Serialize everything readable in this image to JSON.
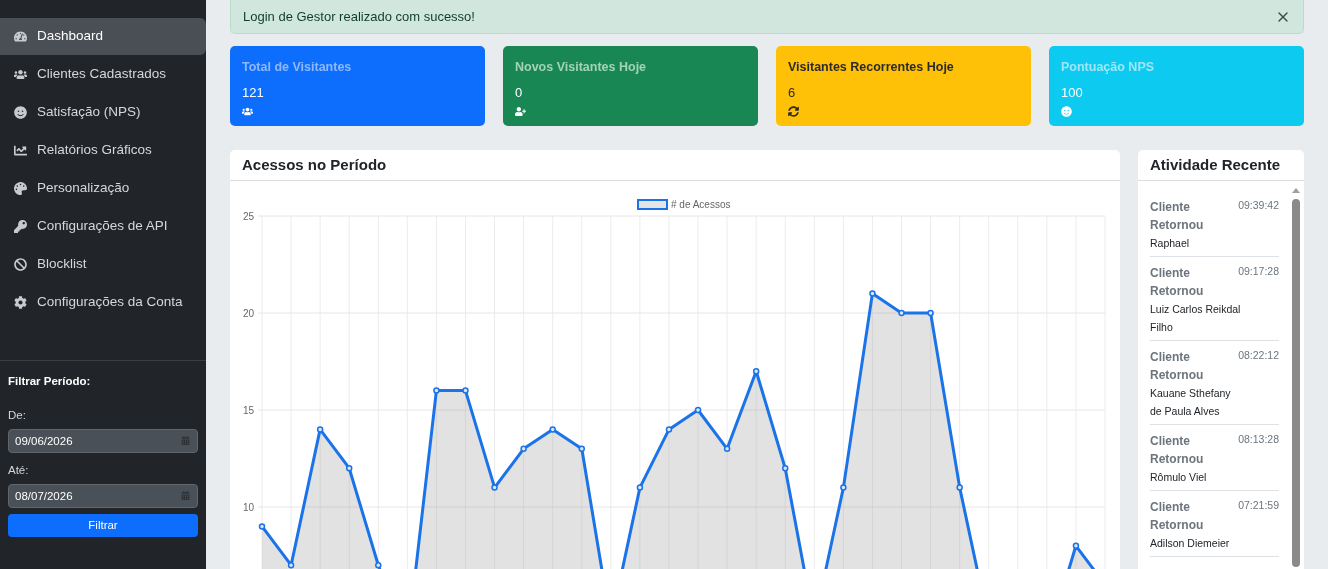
{
  "sidebar": {
    "items": [
      {
        "label": "Dashboard",
        "selected": true
      },
      {
        "label": "Clientes Cadastrados",
        "selected": false
      },
      {
        "label": "Satisfação (NPS)",
        "selected": false
      },
      {
        "label": "Relatórios Gráficos",
        "selected": false
      },
      {
        "label": "Personalização",
        "selected": false
      },
      {
        "label": "Configurações de API",
        "selected": false
      },
      {
        "label": "Blocklist",
        "selected": false
      },
      {
        "label": "Configurações da Conta",
        "selected": false
      }
    ],
    "filter": {
      "title": "Filtrar Período:",
      "from_label": "De:",
      "from_value": "09/06/2026",
      "to_label": "Até:",
      "to_value": "08/07/2026",
      "button": "Filtrar"
    }
  },
  "alert": {
    "text": "Login de Gestor realizado com sucesso!"
  },
  "stat_cards": [
    {
      "title": "Total de Visitantes",
      "value": "121",
      "color": "#0d6efd"
    },
    {
      "title": "Novos Visitantes Hoje",
      "value": "0",
      "color": "#198754"
    },
    {
      "title": "Visitantes Recorrentes Hoje",
      "value": "6",
      "color": "#ffc107"
    },
    {
      "title": "Pontuação NPS",
      "value": "100",
      "color": "#0dcaf0"
    }
  ],
  "access_chart": {
    "title": "Acessos no Período",
    "chart_data": {
      "type": "area",
      "grid": true,
      "marker": true,
      "yticks": [
        10,
        15,
        20,
        25
      ],
      "ylim": [
        0,
        25
      ],
      "series": [
        {
          "name": "# de Acessos",
          "color": "#1a73e8",
          "values": [
            9,
            7,
            14,
            12,
            7,
            3,
            16,
            16,
            11,
            13,
            14,
            13,
            4,
            11,
            14,
            15,
            13,
            17,
            12,
            4,
            11,
            21,
            20,
            20,
            11,
            4,
            3,
            3,
            8,
            6
          ]
        }
      ]
    }
  },
  "recent_activity": {
    "title": "Atividade Recente",
    "items": [
      {
        "title": "Cliente Retornou",
        "time": "09:39:42",
        "name": "Raphael"
      },
      {
        "title": "Cliente Retornou",
        "time": "09:17:28",
        "name": "Luiz Carlos Reikdal Filho"
      },
      {
        "title": "Cliente Retornou",
        "time": "08:22:12",
        "name": "Kauane Sthefany de Paula Alves"
      },
      {
        "title": "Cliente Retornou",
        "time": "08:13:28",
        "name": "Rômulo Viel"
      },
      {
        "title": "Cliente Retornou",
        "time": "07:21:59",
        "name": "Adilson Diemeier"
      }
    ]
  }
}
